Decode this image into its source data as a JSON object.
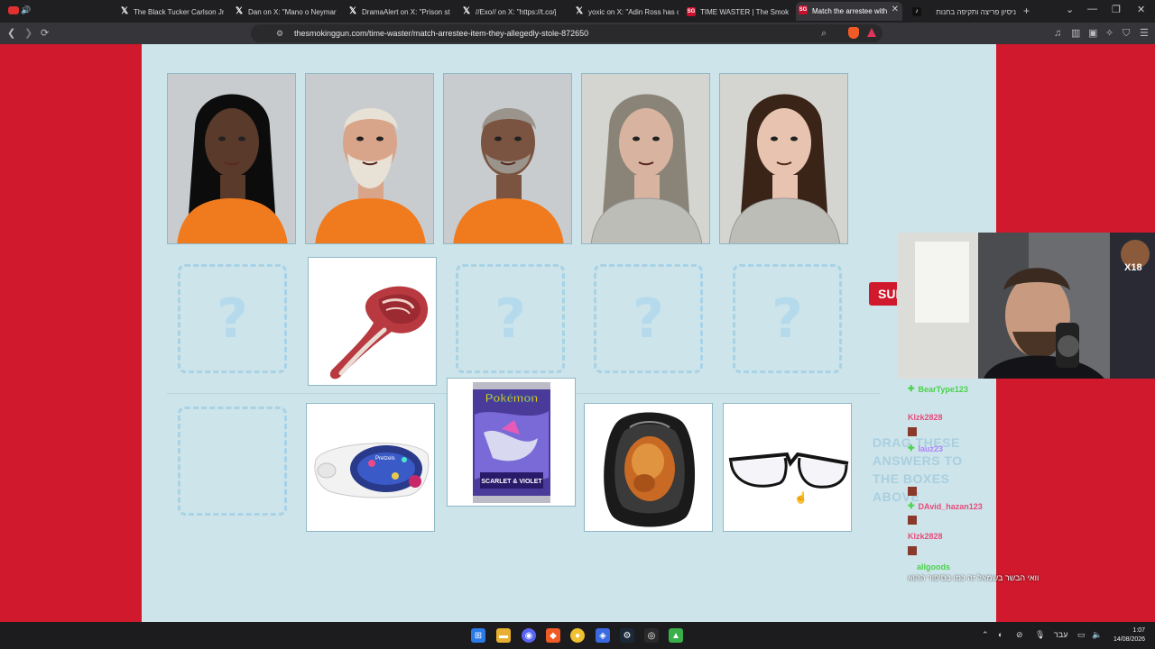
{
  "tabs": [
    {
      "title": "The Black Tucker Carlson Jr",
      "icon": "x-icon"
    },
    {
      "title": "Dan on X: \"Mano o Neymar",
      "icon": "x-icon"
    },
    {
      "title": "DramaAlert on X: \"Prison st",
      "icon": "x-icon"
    },
    {
      "title": "//Exo// on X: \"https://t.co/j",
      "icon": "x-icon"
    },
    {
      "title": "yoxic on X: \"Adin Ross has c",
      "icon": "x-icon"
    },
    {
      "title": "TIME WASTER | The Smoking",
      "icon": "smokinggun-icon"
    },
    {
      "title": "Match the arrestee with",
      "icon": "smokinggun-icon",
      "active": true
    },
    {
      "title": "ניסיון פריצה ותקיפה בחנות",
      "icon": "tiktok-icon"
    }
  ],
  "url": "thesmokinggun.com/time-waster/match-arrestee-item-they-allegedly-stole-872650",
  "game": {
    "slot_placeholder": "?",
    "submit_label": "SUB",
    "drag_hint": "DRAG THESE ANSWERS TO THE BOXES ABOVE",
    "mugshots": [
      {
        "name": "mugshot-woman-black-hair",
        "skin": "#5a3a2a",
        "hair": "#0c0c0c"
      },
      {
        "name": "mugshot-man-white-beard",
        "skin": "#d9a58a",
        "hair": "#e8e2d6"
      },
      {
        "name": "mugshot-man-grey-goatee",
        "skin": "#7a5440",
        "hair": "#9a948c"
      },
      {
        "name": "mugshot-man-long-grey-hair",
        "skin": "#d8b4a0",
        "hair": "#8a8478"
      },
      {
        "name": "mugshot-woman-brown-hair",
        "skin": "#e8c4b0",
        "hair": "#3a2418"
      }
    ],
    "placed_item": "tomahawk-steak",
    "items": [
      "tomahawk-steak",
      "pretzel-tin",
      "pokemon-card-pack",
      "rotisserie-chicken",
      "eyeglasses"
    ]
  },
  "pokemon_pack": {
    "brand": "Pokémon",
    "set": "SCARLET & VIOLET"
  },
  "pretzel_tin": {
    "label": "Pretzels"
  },
  "chat": [
    {
      "user": "BearType123",
      "color": "#4bd24b"
    },
    {
      "user": "Klzk2828",
      "color": "#e84a7a"
    },
    {
      "user": "lauz23",
      "color": "#b080ff"
    },
    {
      "user": "DAvid_hazan123",
      "color": "#e84a7a"
    },
    {
      "user": "Klzk2828",
      "color": "#e84a7a"
    },
    {
      "user": "allgoods",
      "color": "#4bd24b"
    }
  ],
  "chat_message": "וואי הבשר בשמאל זה כמו בסיפור ההוא",
  "webcam_badge": "X18",
  "clock": {
    "time": "1:07",
    "date": "14/08/2026"
  },
  "lang": "עבר"
}
